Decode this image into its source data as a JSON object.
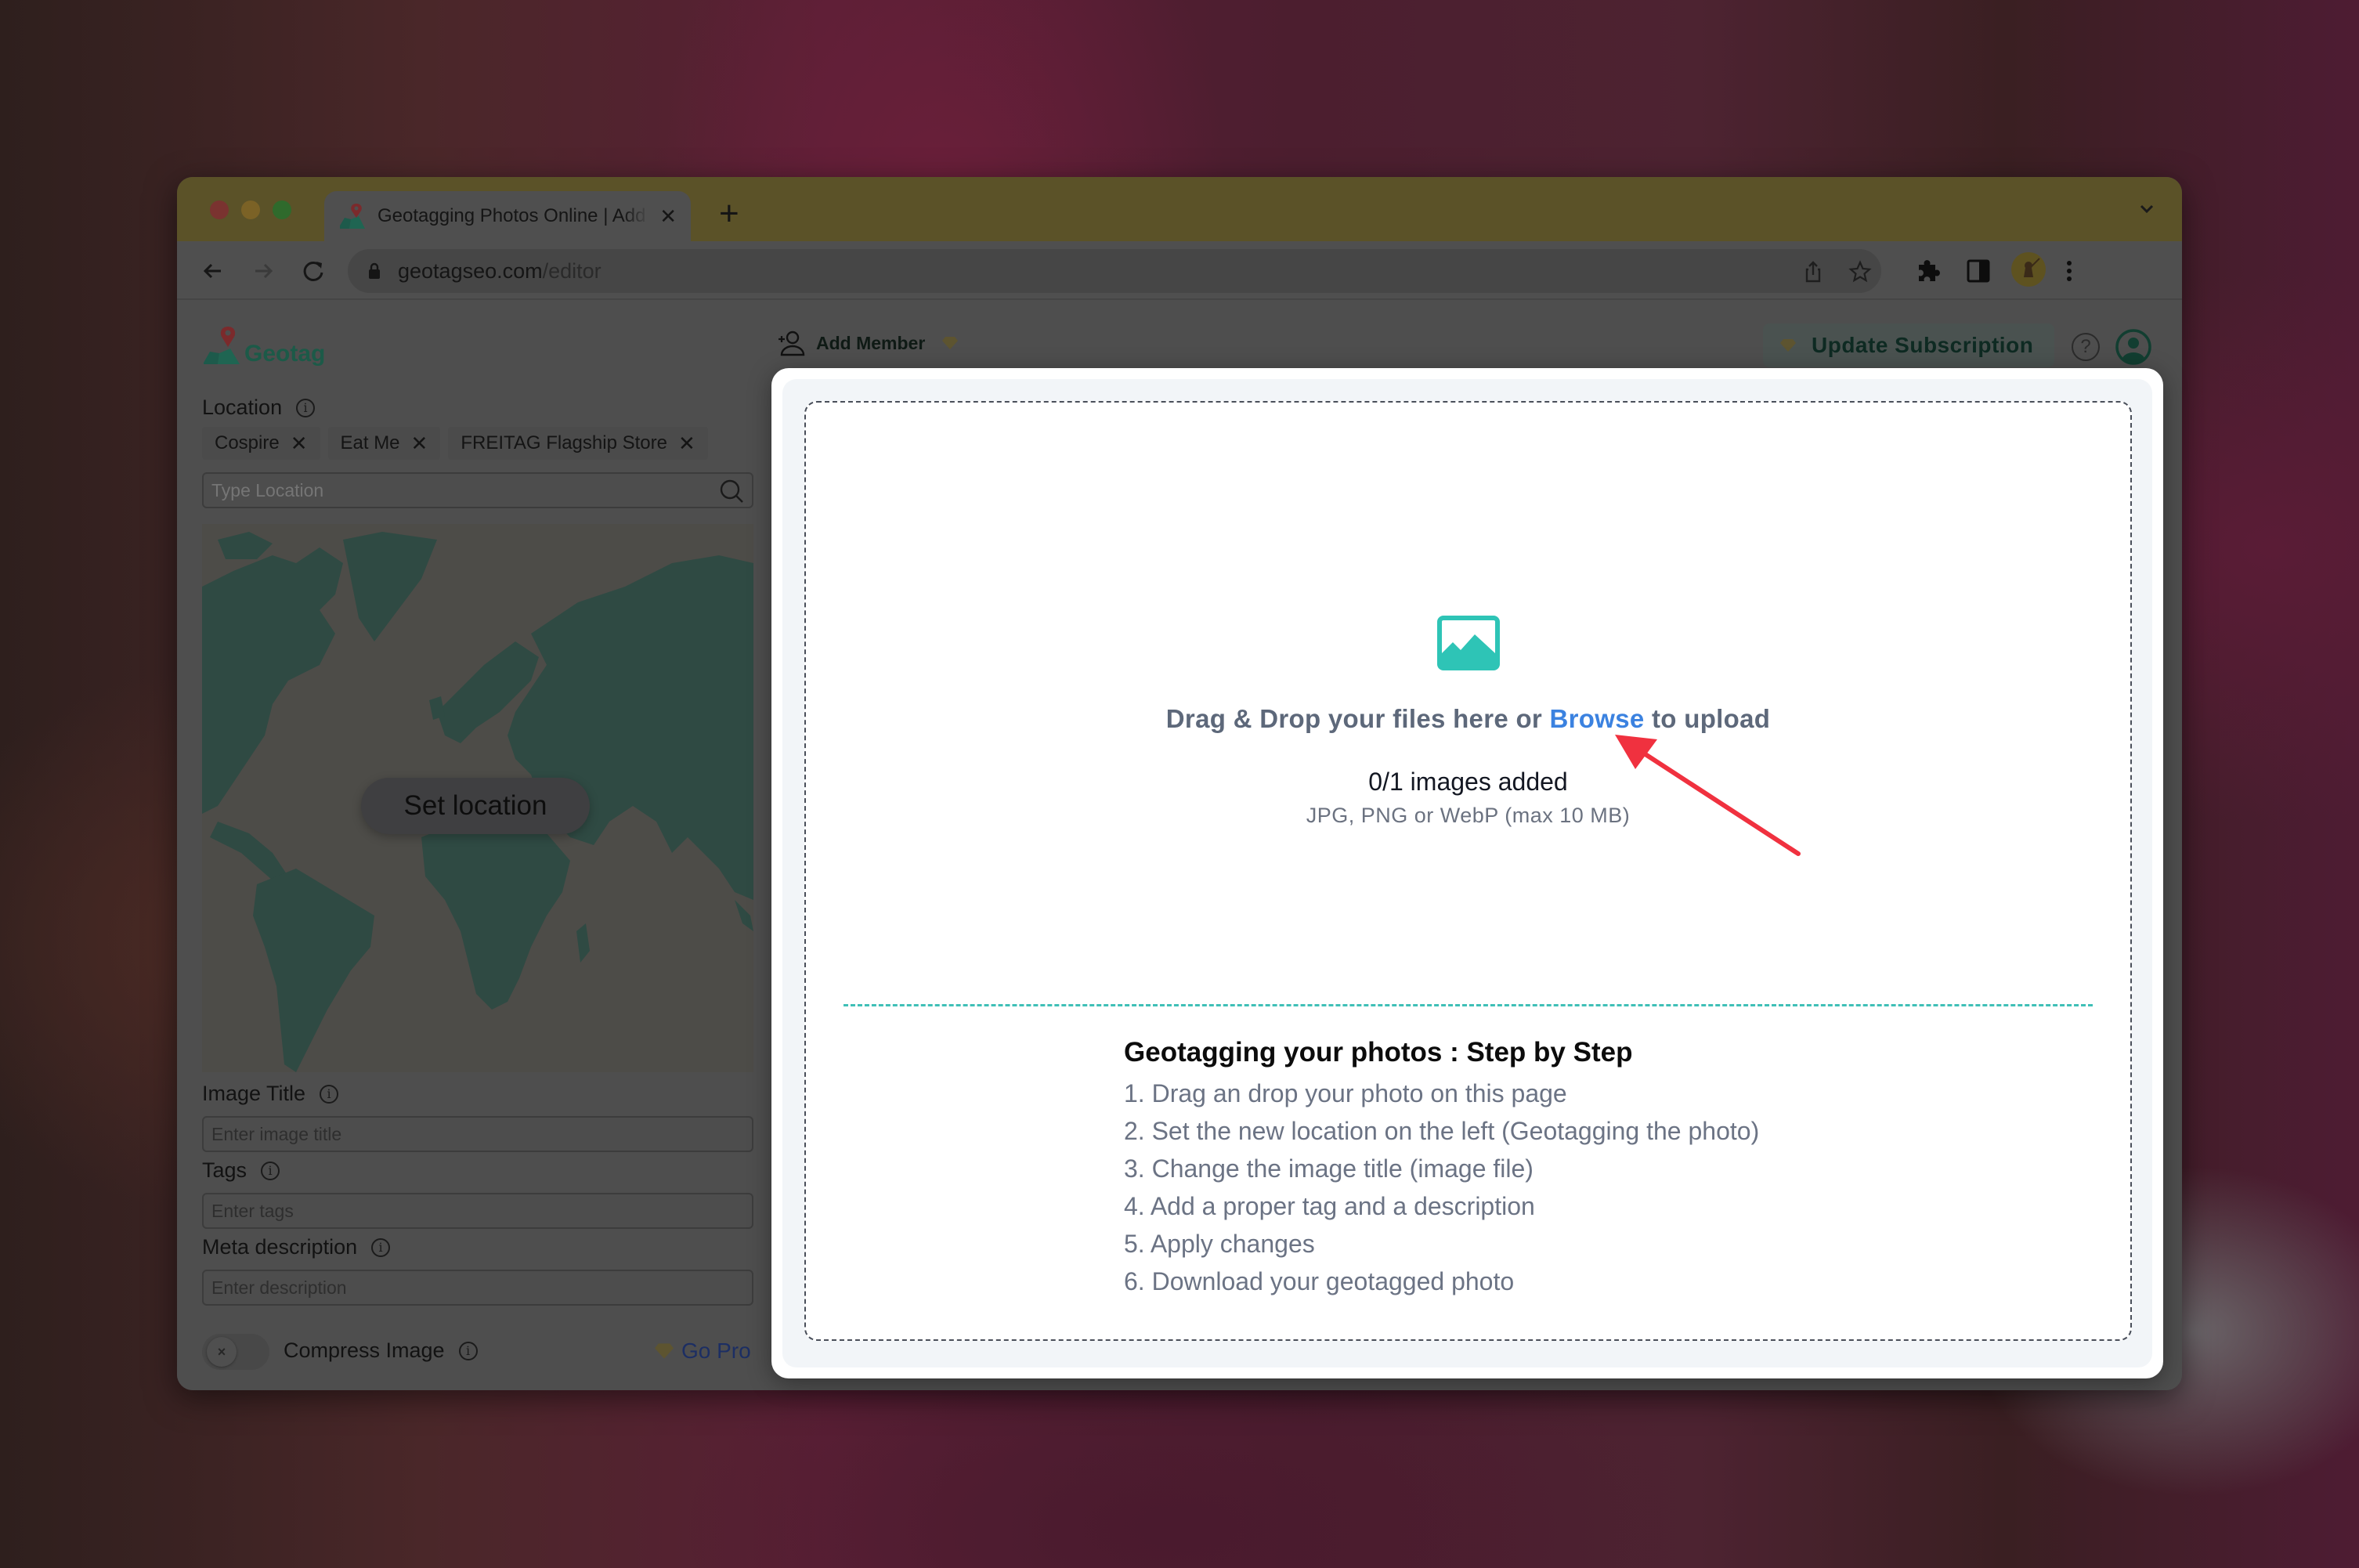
{
  "browser": {
    "tab_title": "Geotagging Photos Online | Add Location to Photos",
    "new_tab_label": "+",
    "tab_close_label": "✕",
    "url_domain": "geotagseo.com",
    "url_path": "/editor"
  },
  "app": {
    "logo_text": "Geotag",
    "header": {
      "add_member_label": "Add Member",
      "update_subscription_label": "Update Subscription",
      "help_label": "?"
    },
    "sidebar": {
      "location_label": "Location",
      "location_chips": [
        {
          "label": "Cospire",
          "remove": "✕"
        },
        {
          "label": "Eat Me",
          "remove": "✕"
        },
        {
          "label": "FREITAG Flagship Store",
          "remove": "✕"
        }
      ],
      "location_placeholder": "Type Location",
      "set_location_label": "Set location",
      "image_title_label": "Image Title",
      "image_title_placeholder": "Enter image title",
      "tags_label": "Tags",
      "tags_placeholder": "Enter tags",
      "meta_description_label": "Meta description",
      "meta_description_placeholder": "Enter description",
      "compress_label": "Compress Image",
      "compress_enabled": false,
      "compress_toggle_glyph": "×",
      "go_pro_label": "Go Pro",
      "info_glyph": "i"
    }
  },
  "modal": {
    "drop_text_before": "Drag & Drop your files here or ",
    "browse_label": "Browse",
    "drop_text_after": " to upload",
    "images_count": "0/1 images added",
    "formats": "JPG, PNG or WebP (max 10 MB)",
    "steps_title": "Geotagging your photos : Step by Step",
    "steps": [
      "1. Drag an drop your photo on this page",
      "2. Set the new location on the left (Geotagging the photo)",
      "3. Change the image title (image file)",
      "4. Add a proper tag and a description",
      "5. Apply changes",
      "6. Download your geotagged photo"
    ]
  },
  "colors": {
    "accent_teal": "#2ec4b6",
    "link_blue": "#3b82e0",
    "annotation_red": "#f0313f",
    "brand_green": "#1c5a48"
  }
}
